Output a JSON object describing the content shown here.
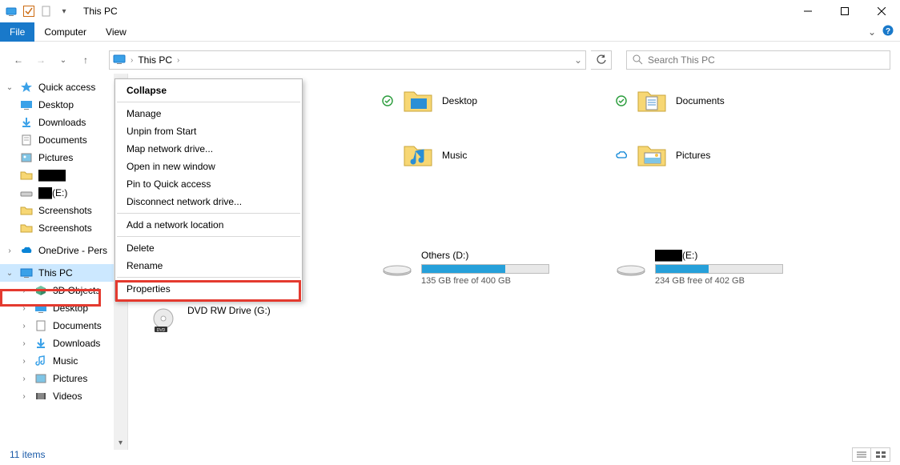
{
  "window": {
    "title": "This PC"
  },
  "ribbon": {
    "file": "File",
    "computer": "Computer",
    "view": "View"
  },
  "address": {
    "location": "This PC"
  },
  "search": {
    "placeholder": "Search This PC"
  },
  "sidebar": {
    "quick_access": "Quick access",
    "desktop": "Desktop",
    "downloads": "Downloads",
    "documents": "Documents",
    "pictures": "Pictures",
    "redacted1": "████",
    "drive_e": "(E:)",
    "screenshots1": "Screenshots",
    "screenshots2": "Screenshots",
    "onedrive": "OneDrive - Pers",
    "this_pc": "This PC",
    "objects3d": "3D Objects",
    "desktop2": "Desktop",
    "documents2": "Documents",
    "downloads2": "Downloads",
    "music": "Music",
    "pictures2": "Pictures",
    "videos": "Videos"
  },
  "folders": {
    "desktop": "Desktop",
    "documents": "Documents",
    "music": "Music",
    "pictures": "Pictures"
  },
  "drives": {
    "d": {
      "label": "Others (D:)",
      "free": "135 GB free of 400 GB",
      "fill_pct": 66
    },
    "e": {
      "label_suffix": "(E:)",
      "free": "234 GB free of 402 GB",
      "fill_pct": 42
    },
    "g": {
      "label": "DVD RW Drive (G:)"
    }
  },
  "context_menu": {
    "collapse": "Collapse",
    "manage": "Manage",
    "unpin": "Unpin from Start",
    "map_drive": "Map network drive...",
    "open_new": "Open in new window",
    "pin_qa": "Pin to Quick access",
    "disconnect": "Disconnect network drive...",
    "add_loc": "Add a network location",
    "delete": "Delete",
    "rename": "Rename",
    "properties": "Properties"
  },
  "status": {
    "items": "11 items"
  }
}
